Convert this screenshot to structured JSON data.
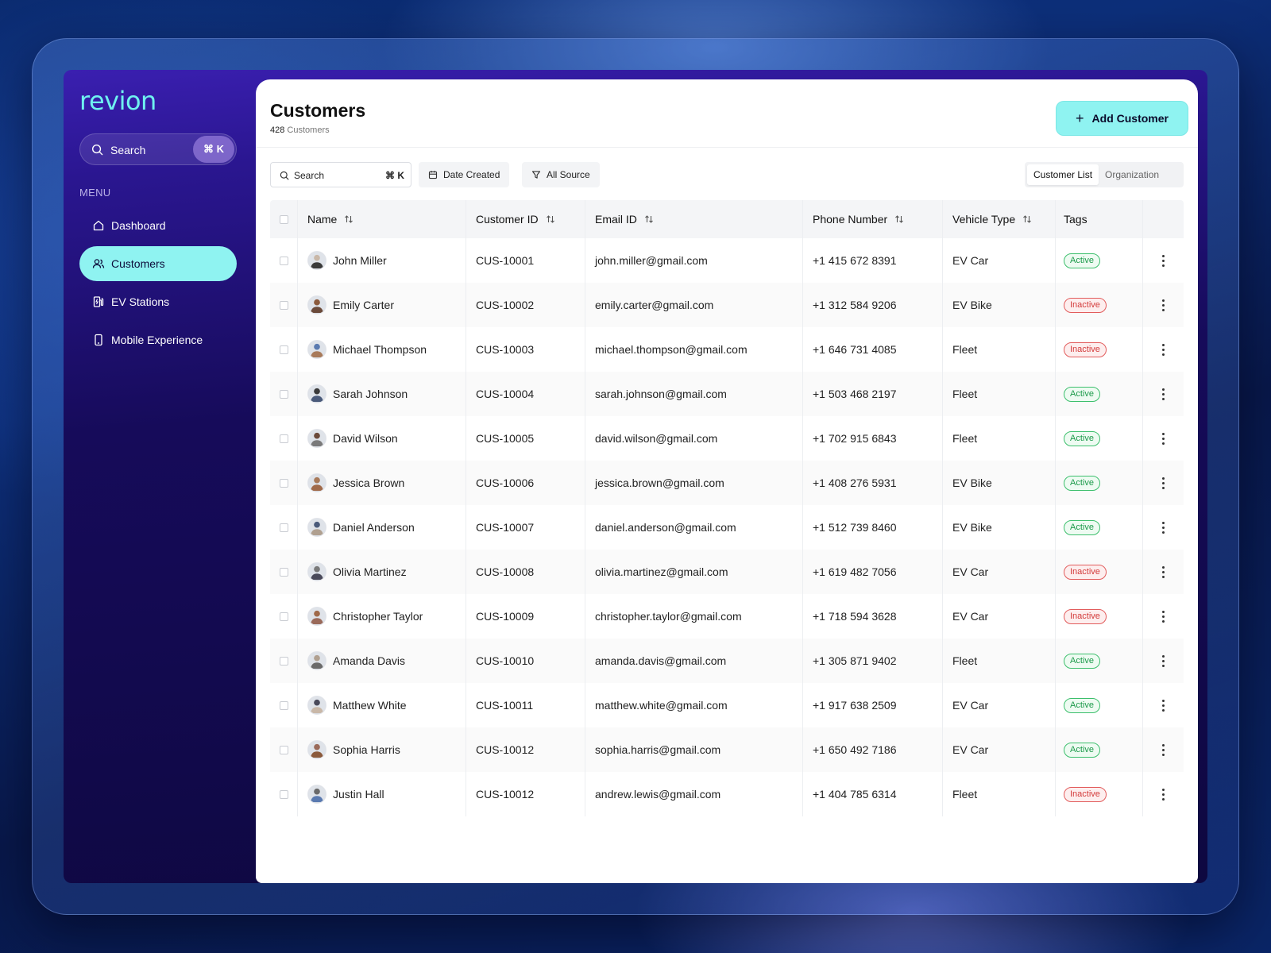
{
  "app": {
    "logo": "revion"
  },
  "sidebar": {
    "search_label": "Search",
    "search_shortcut": "⌘ K",
    "menu_title": "MENU",
    "items": [
      {
        "label": "Dashboard",
        "icon": "home-icon",
        "active": false
      },
      {
        "label": "Customers",
        "icon": "users-icon",
        "active": true
      },
      {
        "label": "EV Stations",
        "icon": "ev-station-icon",
        "active": false
      },
      {
        "label": "Mobile Experience",
        "icon": "mobile-icon",
        "active": false
      }
    ]
  },
  "header": {
    "title": "Customers",
    "count": "428",
    "count_label": "Customers",
    "add_button": "Add Customer"
  },
  "toolbar": {
    "search_placeholder": "Search",
    "search_shortcut": "⌘ K",
    "date_filter": "Date Created",
    "source_filter": "All Source",
    "view_tabs": [
      "Customer List",
      "Organization"
    ],
    "selected_view": "Customer List"
  },
  "table": {
    "columns": [
      "Name",
      "Customer ID",
      "Email ID",
      "Phone Number",
      "Vehicle Type",
      "Tags"
    ],
    "rows": [
      {
        "name": "John Miller",
        "id": "CUS-10001",
        "email": "john.miller@gmail.com",
        "phone": "+1 415 672 8391",
        "vehicle": "EV Car",
        "tag": "Active"
      },
      {
        "name": "Emily Carter",
        "id": "CUS-10002",
        "email": "emily.carter@gmail.com",
        "phone": "+1 312 584 9206",
        "vehicle": "EV Bike",
        "tag": "Inactive"
      },
      {
        "name": "Michael Thompson",
        "id": "CUS-10003",
        "email": "michael.thompson@gmail.com",
        "phone": "+1 646 731 4085",
        "vehicle": "Fleet",
        "tag": "Inactive"
      },
      {
        "name": "Sarah Johnson",
        "id": "CUS-10004",
        "email": "sarah.johnson@gmail.com",
        "phone": "+1 503 468 2197",
        "vehicle": "Fleet",
        "tag": "Active"
      },
      {
        "name": "David Wilson",
        "id": "CUS-10005",
        "email": "david.wilson@gmail.com",
        "phone": "+1 702 915 6843",
        "vehicle": "Fleet",
        "tag": "Active"
      },
      {
        "name": "Jessica Brown",
        "id": "CUS-10006",
        "email": "jessica.brown@gmail.com",
        "phone": "+1 408 276 5931",
        "vehicle": "EV Bike",
        "tag": "Active"
      },
      {
        "name": "Daniel Anderson",
        "id": "CUS-10007",
        "email": "daniel.anderson@gmail.com",
        "phone": "+1 512 739 8460",
        "vehicle": "EV Bike",
        "tag": "Active"
      },
      {
        "name": "Olivia Martinez",
        "id": "CUS-10008",
        "email": "olivia.martinez@gmail.com",
        "phone": "+1 619 482 7056",
        "vehicle": "EV Car",
        "tag": "Inactive"
      },
      {
        "name": "Christopher Taylor",
        "id": "CUS-10009",
        "email": "christopher.taylor@gmail.com",
        "phone": "+1 718 594 3628",
        "vehicle": "EV Car",
        "tag": "Inactive"
      },
      {
        "name": "Amanda Davis",
        "id": "CUS-10010",
        "email": "amanda.davis@gmail.com",
        "phone": "+1 305 871 9402",
        "vehicle": "Fleet",
        "tag": "Active"
      },
      {
        "name": "Matthew White",
        "id": "CUS-10011",
        "email": "matthew.white@gmail.com",
        "phone": "+1 917 638 2509",
        "vehicle": "EV Car",
        "tag": "Active"
      },
      {
        "name": "Sophia Harris",
        "id": "CUS-10012",
        "email": "sophia.harris@gmail.com",
        "phone": "+1 650 492 7186",
        "vehicle": "EV Car",
        "tag": "Active"
      },
      {
        "name": "Justin Hall",
        "id": "CUS-10012",
        "email": "andrew.lewis@gmail.com",
        "phone": "+1 404 785 6314",
        "vehicle": "Fleet",
        "tag": "Inactive"
      }
    ]
  },
  "colors": {
    "accent": "#8ff3f1",
    "logo": "#6ff2f0",
    "active_tag": "#1c9a4a",
    "inactive_tag": "#d33b3b"
  }
}
